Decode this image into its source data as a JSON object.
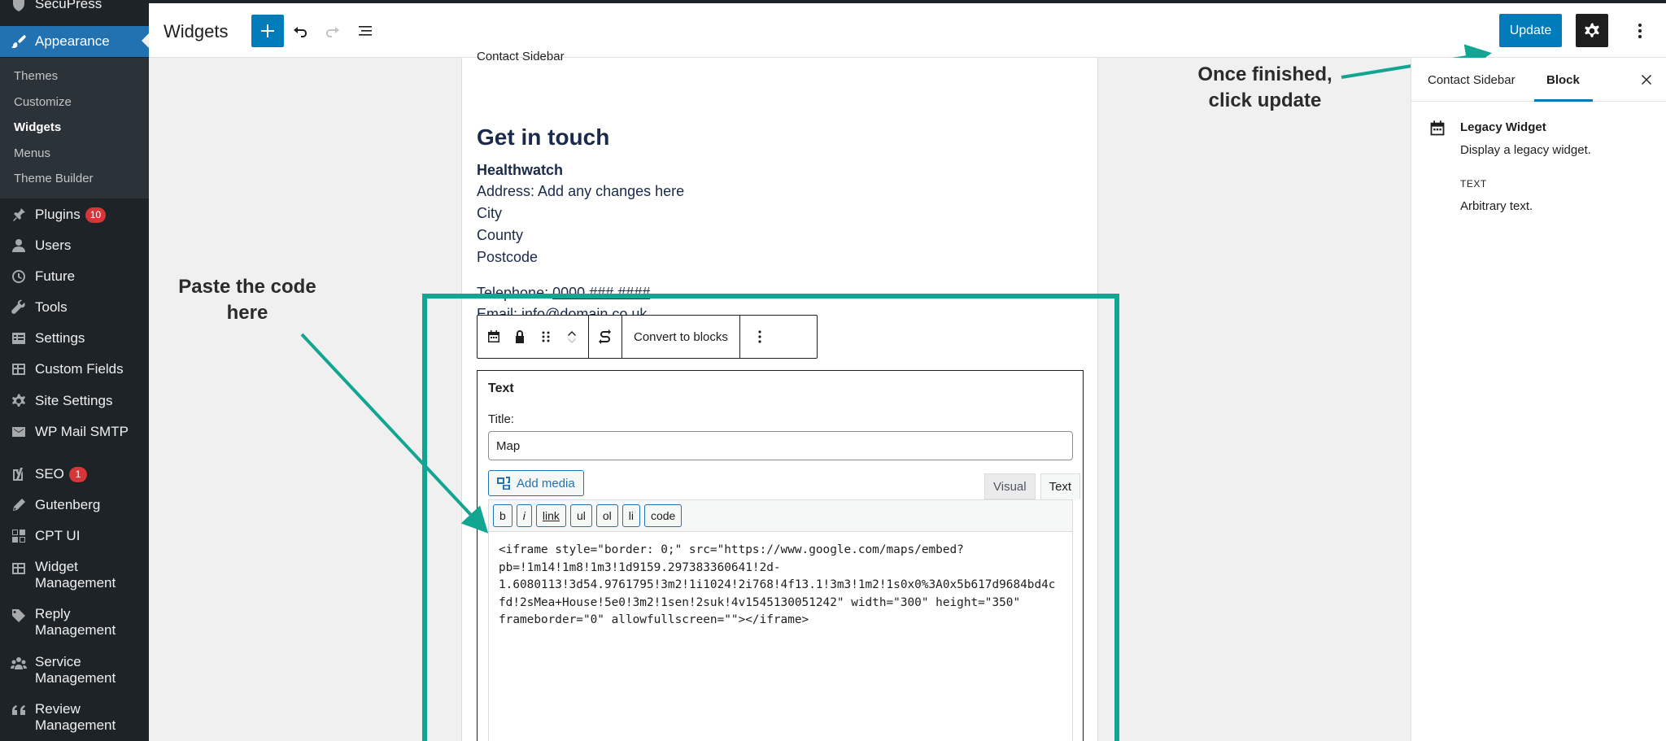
{
  "header": {
    "title": "Widgets",
    "update_label": "Update"
  },
  "sidebar": {
    "partial_top_label": "SecuPress",
    "items": [
      {
        "label": "Appearance",
        "icon": "paintbrush-icon"
      },
      {
        "label": "Plugins",
        "icon": "plugin-icon",
        "badge": "10"
      },
      {
        "label": "Users",
        "icon": "user-icon"
      },
      {
        "label": "Future",
        "icon": "clock-icon"
      },
      {
        "label": "Tools",
        "icon": "wrench-icon"
      },
      {
        "label": "Settings",
        "icon": "settings-icon"
      },
      {
        "label": "Custom Fields",
        "icon": "table-icon"
      },
      {
        "label": "Site Settings",
        "icon": "gear-icon"
      },
      {
        "label": "WP Mail SMTP",
        "icon": "mail-icon"
      },
      {
        "label": "SEO",
        "icon": "yoast-icon",
        "badge": "1"
      },
      {
        "label": "Gutenberg",
        "icon": "pen-icon"
      },
      {
        "label": "CPT UI",
        "icon": "grid-icon"
      },
      {
        "label_line1": "Widget",
        "label_line2": "Management",
        "icon": "table-icon"
      },
      {
        "label_line1": "Reply",
        "label_line2": "Management",
        "icon": "tag-icon"
      },
      {
        "label_line1": "Service",
        "label_line2": "Management",
        "icon": "groups-icon"
      },
      {
        "label_line1": "Review",
        "label_line2": "Management",
        "icon": "quote-icon"
      }
    ],
    "submenu": [
      "Themes",
      "Customize",
      "Widgets",
      "Menus",
      "Theme Builder"
    ]
  },
  "canvas": {
    "cut_text": "Contact Sidebar",
    "heading": "Get in touch",
    "org": "Healthwatch",
    "address": "Address: Add any changes here",
    "city": "City",
    "county": "County",
    "postcode": "Postcode",
    "tel_label": "Telephone:",
    "tel_value": "0000 ### ####",
    "email_label": "Email:",
    "email_value": "info@domain.co.uk"
  },
  "toolbar": {
    "convert_label": "Convert to blocks"
  },
  "widget": {
    "title": "Text",
    "field_label": "Title:",
    "field_value": "Map",
    "add_media": "Add media",
    "tab_visual": "Visual",
    "tab_text": "Text",
    "quicktags": [
      "b",
      "i",
      "link",
      "ul",
      "ol",
      "li",
      "code"
    ],
    "code_line1": "<iframe style=\"border: 0;\" src=\"https://www.google.com/maps/embed?",
    "code_line2": "pb=!1m14!1m8!1m3!1d9159.297383360641!2d-",
    "code_line3": "1.6080113!3d54.9761795!3m2!1i1024!2i768!4f13.1!3m3!1m2!1s0x0%3A0x5b617d9684bd4c",
    "code_line4": "fd!2sMea+House!5e0!3m2!1sen!2suk!4v1545130051242\" width=\"300\" height=\"350\"",
    "code_line5": "frameborder=\"0\" allowfullscreen=\"\"></iframe>"
  },
  "annotations": {
    "paste_line1": "Paste the code",
    "paste_line2": "here",
    "finished_line1": "Once finished,",
    "finished_line2": "click update",
    "accent": "#12a592"
  },
  "panel": {
    "tab_sidebar": "Contact Sidebar",
    "tab_block": "Block",
    "block_title": "Legacy Widget",
    "block_desc": "Display a legacy widget.",
    "caption": "TEXT",
    "caption_value": "Arbitrary text."
  },
  "colors": {
    "admin_bg": "#1d2327",
    "accent_blue": "#007cba",
    "highlight_green": "#12a592"
  }
}
